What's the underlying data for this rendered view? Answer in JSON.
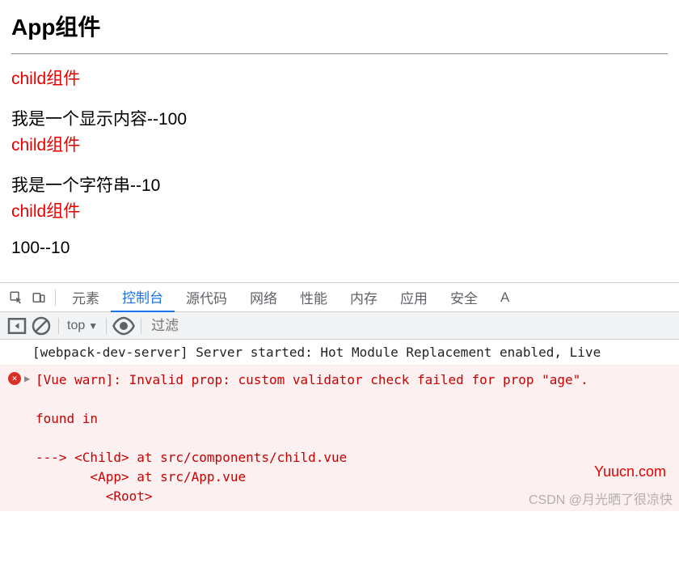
{
  "app": {
    "title": "App组件",
    "blocks": [
      {
        "child_label": "child组件",
        "content": "我是一个显示内容--100"
      },
      {
        "child_label": "child组件",
        "content": "我是一个字符串--10"
      },
      {
        "child_label": "child组件",
        "content": "100--10"
      }
    ]
  },
  "devtools": {
    "tabs": [
      "元素",
      "控制台",
      "源代码",
      "网络",
      "性能",
      "内存",
      "应用",
      "安全",
      "A"
    ],
    "active_tab": "控制台",
    "toolbar": {
      "context": "top",
      "filter_placeholder": "过滤"
    }
  },
  "console": {
    "info_line": "[webpack-dev-server] Server started: Hot Module Replacement enabled, Live ",
    "error": {
      "header": "[Vue warn]: Invalid prop: custom validator check failed for prop \"age\".",
      "found_in": "found in",
      "trace": [
        "---> <Child> at src/components/child.vue",
        "       <App> at src/App.vue",
        "         <Root>"
      ]
    }
  },
  "watermarks": {
    "yuu": "Yuucn.com",
    "csdn": "CSDN @月光晒了很凉快"
  }
}
